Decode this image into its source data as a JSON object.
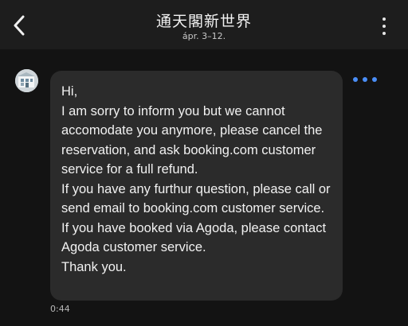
{
  "header": {
    "title": "通天閣新世界",
    "subtitle": "ápr. 3–12.",
    "back_icon": "chevron-left-icon",
    "more_icon": "vertical-ellipsis-icon"
  },
  "message": {
    "text": "Hi,\nI am sorry to inform you but we cannot accomodate you anymore, please cancel the reservation, and ask booking.com customer service for a full refund.\nIf you have any furthur question, please call or send email to booking.com customer service.\nIf you have booked via Agoda, please contact Agoda customer service.\nThank you.",
    "time": "0:44",
    "options_icon": "horizontal-ellipsis-icon"
  },
  "colors": {
    "background": "#131313",
    "header": "#1d1d1d",
    "bubble": "#2b2b2b",
    "accent": "#4a8ef7"
  }
}
